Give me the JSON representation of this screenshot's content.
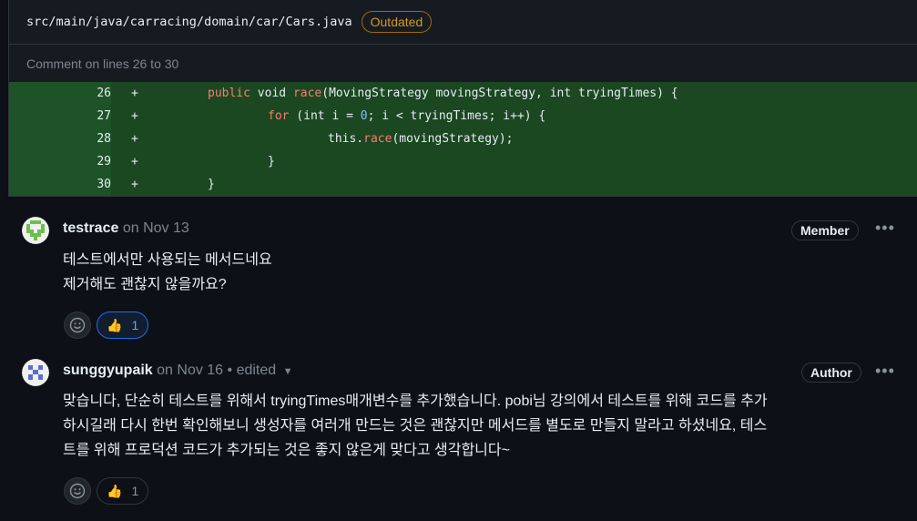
{
  "file": {
    "path": "src/main/java/carracing/domain/car/Cars.java",
    "badge": "Outdated",
    "comment_range": "Comment on lines 26 to 30"
  },
  "code_lines": [
    {
      "num": "26",
      "sign": "+"
    },
    {
      "num": "27",
      "sign": "+"
    },
    {
      "num": "28",
      "sign": "+"
    },
    {
      "num": "29",
      "sign": "+"
    },
    {
      "num": "30",
      "sign": "+"
    }
  ],
  "code_text": {
    "l26_kw1": "public",
    "l26_kw2": "void",
    "l26_fn": "race",
    "l26_rest": "(MovingStrategy movingStrategy, int tryingTimes) {",
    "l27_kw": "for",
    "l27_a": " (int i = ",
    "l27_num": "0",
    "l27_b": "; i < tryingTimes; i++) {",
    "l28_a": "this.",
    "l28_fn": "race",
    "l28_b": "(movingStrategy);",
    "l29": "}",
    "l30": "}"
  },
  "comments": [
    {
      "author": "testrace",
      "meta": "on Nov 13",
      "role": "Member",
      "line1": "테스트에서만 사용되는 메서드네요",
      "line2": "제거해도 괜찮지 않을까요?",
      "reaction_count": "1"
    },
    {
      "author": "sunggyupaik",
      "meta": "on Nov 16 • edited",
      "role": "Author",
      "line1": "맞습니다, 단순히 테스트를 위해서 tryingTimes매개변수를 추가했습니다. pobi님 강의에서 테스트를 위해 코드를 추가",
      "line2": "하시길래 다시 한번 확인해보니 생성자를 여러개 만드는 것은 괜찮지만 메서드를 별도로 만들지 말라고 하셨네요, 테스",
      "line3": "트를 위해 프로덕션 코드가 추가되는 것은 좋지 않은게 맞다고 생각합니다~",
      "reaction_count": "1"
    }
  ],
  "icons": {
    "more": "kebab-horizontal-icon",
    "emoji": "smiley-icon",
    "thumbs": "thumbs-up-icon",
    "caret": "caret-down-icon"
  },
  "colors": {
    "background": "#0d1117",
    "added_line": "#1b4721",
    "outdated": "#d29922",
    "reaction_active": "#1f6feb"
  }
}
